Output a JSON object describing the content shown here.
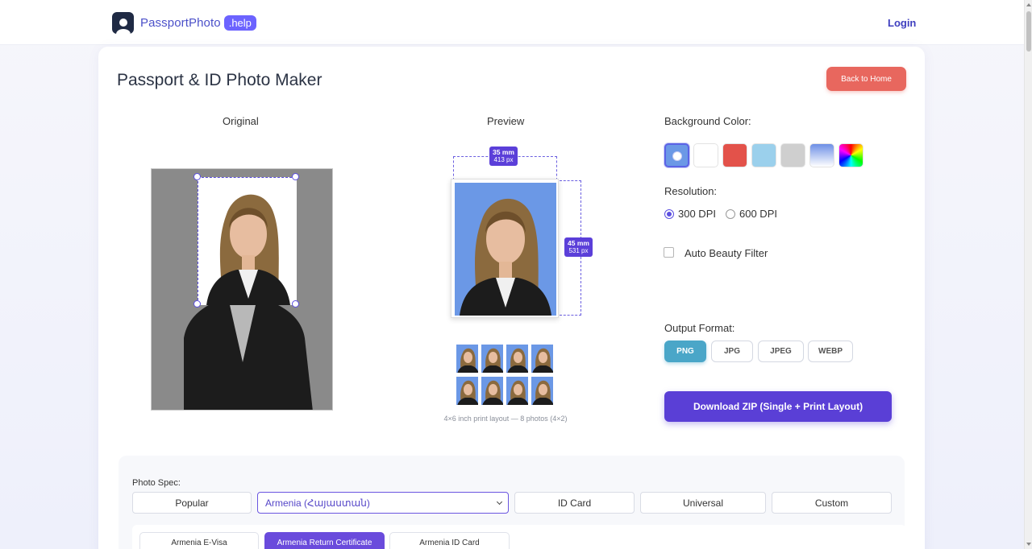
{
  "header": {
    "logo_text": "PassportPhoto",
    "logo_badge": ".help",
    "login_label": "Login"
  },
  "page": {
    "title": "Passport & ID Photo Maker",
    "back_label": "Back to Home"
  },
  "original": {
    "label": "Original"
  },
  "preview": {
    "label": "Preview",
    "width_mm": "35 mm",
    "width_px": "413 px",
    "height_mm": "45 mm",
    "height_px": "531 px",
    "print_caption": "4×6 inch print layout — 8 photos (4×2)"
  },
  "settings": {
    "background_label": "Background Color:",
    "swatches": [
      {
        "name": "current",
        "color": "#6b98e6",
        "selected": true
      },
      {
        "name": "white",
        "color": "#ffffff"
      },
      {
        "name": "red",
        "color": "#e3524a"
      },
      {
        "name": "light-blue",
        "color": "#9bd0ec"
      },
      {
        "name": "gray",
        "color": "#cfcfcf"
      },
      {
        "name": "gradient-blue",
        "color": "linear-gradient(180deg,#6d8fe6,#ffffff)"
      },
      {
        "name": "rainbow",
        "color": "conic-gradient(red, yellow, lime, cyan, blue, magenta, red)"
      }
    ],
    "resolution_label": "Resolution:",
    "resolution_options": [
      "300 DPI",
      "600 DPI"
    ],
    "resolution_selected": "300 DPI",
    "beauty_label": "Auto Beauty Filter",
    "output_label": "Output Format:",
    "formats": [
      "PNG",
      "JPG",
      "JPEG",
      "WEBP"
    ],
    "format_selected": "PNG",
    "download_label": "Download ZIP (Single + Print Layout)"
  },
  "spec": {
    "label": "Photo Spec:",
    "popular": "Popular",
    "country_selected": "Armenia (Հայաստան)",
    "id_card": "ID Card",
    "universal": "Universal",
    "custom": "Custom",
    "sub_tabs": [
      "Armenia E-Visa",
      "Armenia Return Certificate",
      "Armenia ID Card"
    ],
    "sub_tab_selected": "Armenia Return Certificate"
  }
}
